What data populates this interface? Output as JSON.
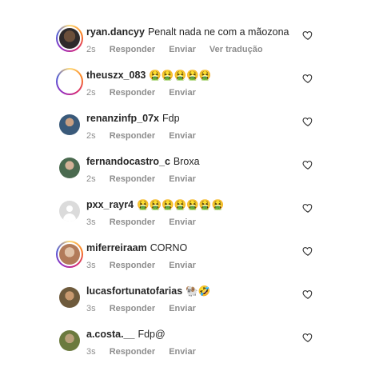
{
  "comments": [
    {
      "username": "ryan.dancyy",
      "text": "Penalt nada ne com a mãozona",
      "time": "2s",
      "reply": "Responder",
      "send": "Enviar",
      "translate": "Ver tradução",
      "avatar": "ring"
    },
    {
      "username": "theuszx_083",
      "text": "🤮🤮🤮🤮🤮",
      "time": "2s",
      "reply": "Responder",
      "send": "Enviar",
      "avatar": "ring-blank"
    },
    {
      "username": "renanzinfp_07x",
      "text": "Fdp",
      "time": "2s",
      "reply": "Responder",
      "send": "Enviar",
      "avatar": "plain"
    },
    {
      "username": "fernandocastro_c",
      "text": "Broxa",
      "time": "2s",
      "reply": "Responder",
      "send": "Enviar",
      "avatar": "plain"
    },
    {
      "username": "pxx_rayr4",
      "text": "🤮🤮🤮🤮🤮🤮🤮",
      "time": "3s",
      "reply": "Responder",
      "send": "Enviar",
      "avatar": "default"
    },
    {
      "username": "miferreiraam",
      "text": "CORNO",
      "time": "3s",
      "reply": "Responder",
      "send": "Enviar",
      "avatar": "ring"
    },
    {
      "username": "lucasfortunatofarias",
      "text": "🐏🤣",
      "time": "3s",
      "reply": "Responder",
      "send": "Enviar",
      "avatar": "plain"
    },
    {
      "username": "a.costa.__",
      "text": "Fdp@",
      "time": "3s",
      "reply": "Responder",
      "send": "Enviar",
      "avatar": "plain"
    }
  ],
  "icons": {
    "like": "heart-outline-icon"
  },
  "colors": {
    "text": "#262626",
    "meta": "#8e8e8e",
    "ring": "#d62976"
  }
}
